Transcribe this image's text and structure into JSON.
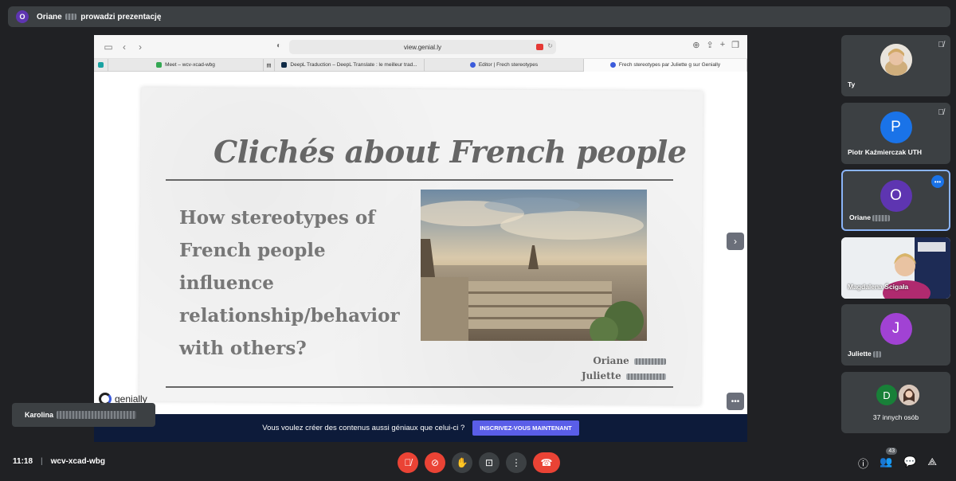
{
  "presenter": {
    "initial": "O",
    "name": "Oriane",
    "label": "prowadzi prezentację",
    "avatar_color": "#5e35b1"
  },
  "browser": {
    "url": "view.genial.ly",
    "tabs": [
      {
        "label": "Meet – wcv-xcad-wbg",
        "icon_color": "#34a853"
      },
      {
        "label": "DeepL Traduction – DeepL Translate : le meilleur trad...",
        "icon_color": "#0f2b46"
      },
      {
        "label": "Editor | Frech stereotypes",
        "icon_color": "#3b5bdb"
      },
      {
        "label": "Frech stereotypes par Juliette g sur Genially",
        "icon_color": "#3b5bdb"
      }
    ]
  },
  "slide": {
    "title": "Clichés about French people",
    "question_lines": [
      "How stereotypes of",
      "French people influence",
      "relationship/behavior",
      "with others?"
    ],
    "author_1": "Oriane",
    "author_2": "Juliette",
    "brand": "genially"
  },
  "cta": {
    "text": "Vous voulez créer des contenus aussi géniaux que celui-ci ?",
    "button": "INSCRIVEZ-VOUS MAINTENANT"
  },
  "participants": [
    {
      "name": "Ty",
      "kind": "photo",
      "muted": true
    },
    {
      "name": "Piotr Kaźmierczak UTH",
      "initial": "P",
      "color": "#1a73e8",
      "muted": true
    },
    {
      "name": "Oriane",
      "initial": "O",
      "color": "#5e35b1",
      "active": true
    },
    {
      "name": "Magdalena Ścigała",
      "kind": "video"
    },
    {
      "name": "Juliette",
      "initial": "J",
      "color": "#a142d4"
    },
    {
      "name": "37 innych osób",
      "initial": "D",
      "color": "#188038"
    }
  ],
  "self_view": {
    "name": "Karolina"
  },
  "meeting": {
    "time": "11:18",
    "code": "wcv-xcad-wbg"
  },
  "people_count": "43",
  "icons": {
    "mic": "mic-off-icon",
    "camera": "camera-off-icon",
    "hand": "raise-hand-icon",
    "present": "present-icon",
    "more": "more-vert-icon",
    "end": "end-call-icon",
    "info": "info-icon",
    "people": "people-icon",
    "chat": "chat-icon",
    "activities": "activities-icon"
  }
}
